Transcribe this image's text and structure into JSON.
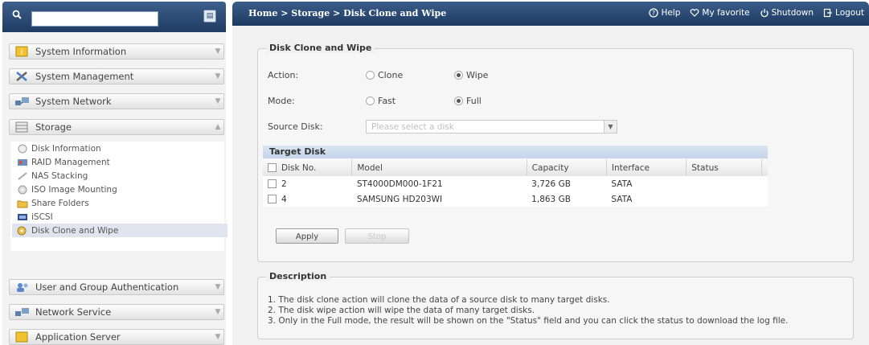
{
  "search": {
    "value": "",
    "placeholder": ""
  },
  "sidebar": {
    "menus": [
      {
        "label": "System Information",
        "icon": "info-icon"
      },
      {
        "label": "System Management",
        "icon": "tools-icon"
      },
      {
        "label": "System Network",
        "icon": "network-icon"
      },
      {
        "label": "Storage",
        "icon": "storage-icon"
      }
    ],
    "storage_items": [
      {
        "label": "Disk Information",
        "icon": "disk-info-icon"
      },
      {
        "label": "RAID Management",
        "icon": "raid-icon"
      },
      {
        "label": "NAS Stacking",
        "icon": "stacking-icon"
      },
      {
        "label": "ISO Image Mounting",
        "icon": "iso-icon"
      },
      {
        "label": "Share Folders",
        "icon": "folder-icon"
      },
      {
        "label": "iSCSI",
        "icon": "iscsi-icon"
      },
      {
        "label": "Disk Clone and Wipe",
        "icon": "disk-clone-icon"
      }
    ],
    "bottom_menus": [
      {
        "label": "User and Group Authentication",
        "icon": "users-icon"
      },
      {
        "label": "Network Service",
        "icon": "network-service-icon"
      },
      {
        "label": "Application Server",
        "icon": "app-server-icon"
      }
    ]
  },
  "header": {
    "breadcrumb": "Home > Storage > Disk Clone and Wipe",
    "help": "Help",
    "favorite": "My favorite",
    "shutdown": "Shutdown",
    "logout": "Logout"
  },
  "form": {
    "legend": "Disk Clone and Wipe",
    "action_label": "Action:",
    "action_options": [
      "Clone",
      "Wipe"
    ],
    "action_selected": "Wipe",
    "mode_label": "Mode:",
    "mode_options": [
      "Fast",
      "Full"
    ],
    "mode_selected": "Full",
    "source_label": "Source Disk:",
    "source_placeholder": "Please select a disk"
  },
  "target": {
    "title": "Target Disk",
    "columns": [
      "Disk No.",
      "Model",
      "Capacity",
      "Interface",
      "Status"
    ],
    "rows": [
      {
        "disk": "2",
        "model": "ST4000DM000-1F21",
        "capacity": "3,726 GB",
        "interface": "SATA",
        "status": ""
      },
      {
        "disk": "4",
        "model": "SAMSUNG HD203WI",
        "capacity": "1,863 GB",
        "interface": "SATA",
        "status": ""
      }
    ],
    "apply_label": "Apply",
    "stop_label": "Stop"
  },
  "description": {
    "legend": "Description",
    "lines": [
      "1. The disk clone action will clone the data of a source disk to many target disks.",
      "2. The disk wipe action will wipe the data of many target disks.",
      "3. Only in the Full mode, the result will be shown on the \"Status\" field and you can click the status to download the log file."
    ]
  },
  "colors": {
    "header_blue": "#2b4a72",
    "active_item": "#dfe4ee"
  }
}
